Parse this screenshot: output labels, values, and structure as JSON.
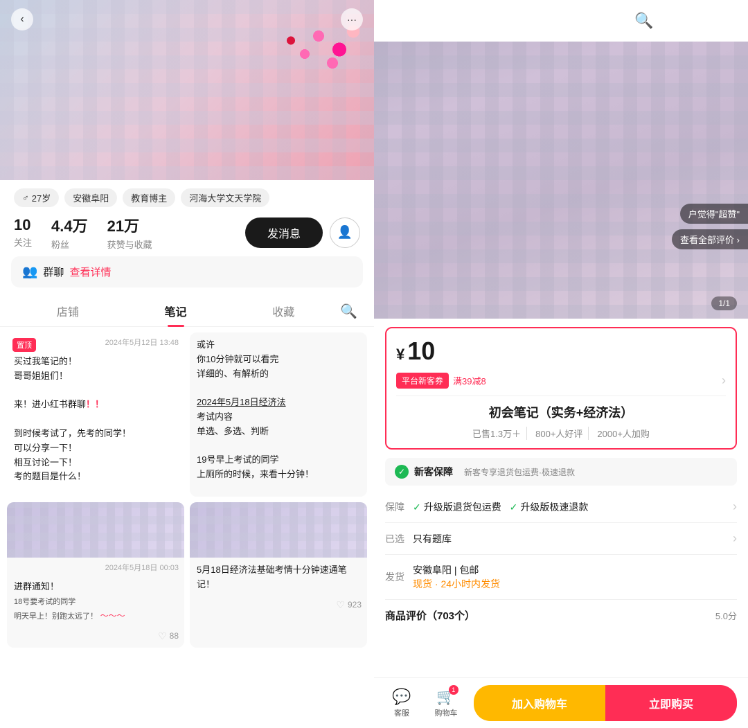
{
  "left": {
    "back_label": "‹",
    "more_label": "···",
    "tags": [
      {
        "icon": "♂",
        "label": "27岁"
      },
      {
        "label": "安徽阜阳"
      },
      {
        "label": "教育博主"
      },
      {
        "label": "河海大学文天学院"
      }
    ],
    "stats": [
      {
        "num": "10",
        "label": "关注"
      },
      {
        "num": "4.4万",
        "label": "粉丝"
      },
      {
        "num": "21万",
        "label": "获赞与收藏"
      }
    ],
    "message_btn": "发消息",
    "group_bar": {
      "icon": "👥",
      "text": "群聊",
      "link": "查看详情"
    },
    "tabs": [
      {
        "label": "店铺"
      },
      {
        "label": "笔记",
        "active": true
      },
      {
        "label": "收藏"
      }
    ],
    "search_label": "🔍",
    "notes": [
      {
        "pinned": true,
        "badge": "置顶",
        "date": "2024年5月12日 13:48",
        "content": "买过我笔记的！\n哥哥姐姐们！\n\n来！进小红书群聊！！\n\n到时候考试了，先考的同学！\n可以分享一下！\n相互讨论一下！\n考的题目是什么！",
        "likes": ""
      },
      {
        "pinned": false,
        "content": "或许\n你10分钟就可以看完\n详细的、有解析的\n\n2024年5月18日经济法\n考试内容\n单选、多选、判断\n\n19号早上考试的同学\n上厕所的时候，来看十分钟！",
        "likes": ""
      },
      {
        "pinned": false,
        "date": "2024年5月18日 00:03",
        "content": "进群通知！",
        "sub_content": "18号要考试的同学\n明天早上！别跑太远了！",
        "likes": "88",
        "has_image": true
      },
      {
        "pinned": false,
        "content": "5月18日经济法基础考情十分钟速通笔记！",
        "likes": "923",
        "has_image": true
      }
    ]
  },
  "right": {
    "back_label": "‹",
    "icons": [
      "🔍",
      "☆",
      "⬆"
    ],
    "price": {
      "symbol": "¥",
      "num": "10"
    },
    "voucher": {
      "tag": "平台新客券",
      "text": "满39减8"
    },
    "product_title": "初会笔记（实务+经济法）",
    "product_stats": {
      "sold": "已售1.3万＋",
      "good_reviews": "800+人好评",
      "added": "2000+人加购"
    },
    "guarantee": {
      "title": "新客保障",
      "desc": "新客专享退货包运费·极速退款"
    },
    "details": [
      {
        "label": "保障",
        "value_parts": [
          "升级版退货包运费",
          "升级版极速退款"
        ],
        "has_checks": true
      },
      {
        "label": "已选",
        "value": "只有题库"
      },
      {
        "label": "发货",
        "value": "安徽阜阳 | 包邮",
        "sub": "现货  ·  24小时内发货",
        "sub_color": "green"
      }
    ],
    "reviews": {
      "title": "商品评价（703个）",
      "score": "5.0分"
    },
    "review_overlay": {
      "badge": "户觉得\"超赞\"",
      "view_all": "查看全部评价 ›"
    },
    "page_indicator": "1/1",
    "bottom_bar": {
      "customer_service": "客服",
      "cart": "购物车",
      "cart_badge": "1",
      "add_cart": "加入购物车",
      "buy_now": "立即购买"
    }
  }
}
